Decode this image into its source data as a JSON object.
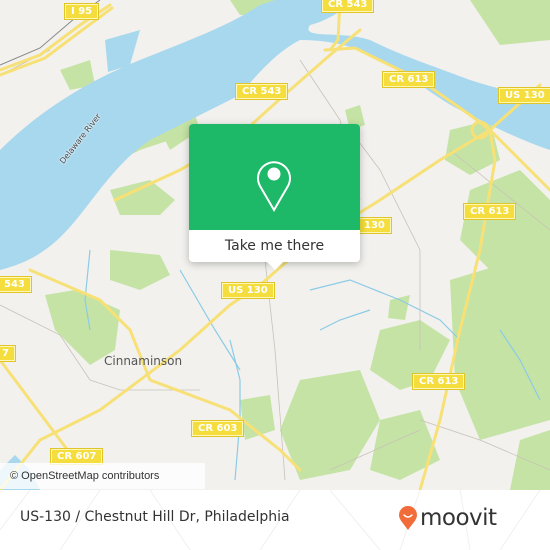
{
  "map": {
    "place_labels": [
      {
        "id": "cinnaminson",
        "text": "Cinnaminson"
      }
    ],
    "water_labels": [
      {
        "id": "delaware-river",
        "text": "Delaware River"
      }
    ],
    "road_shields": [
      {
        "id": "i95",
        "text": "I 95"
      },
      {
        "id": "cr543-top",
        "text": "CR 543"
      },
      {
        "id": "cr543-mid",
        "text": "CR 543"
      },
      {
        "id": "cr543-left",
        "text": "543"
      },
      {
        "id": "cr613-top",
        "text": "CR 613"
      },
      {
        "id": "us130-right",
        "text": "US 130"
      },
      {
        "id": "cr613-right",
        "text": "CR 613"
      },
      {
        "id": "us130-center",
        "text": "130"
      },
      {
        "id": "us130-left",
        "text": "US 130"
      },
      {
        "id": "cr607-left",
        "text": "7"
      },
      {
        "id": "cr613-bottom",
        "text": "CR 613"
      },
      {
        "id": "cr603",
        "text": "CR 603"
      },
      {
        "id": "cr607",
        "text": "CR 607"
      }
    ],
    "attribution": "© OpenStreetMap contributors",
    "colors": {
      "land": "#f2f1ee",
      "water": "#a8d8ee",
      "park": "#c5e3a5",
      "road": "#f7e176",
      "shield": "#f4dd3c"
    }
  },
  "popup": {
    "icon": "location-pin-icon",
    "button_label": "Take me there",
    "color": "#1db868"
  },
  "footer": {
    "title": "US-130 / Chestnut Hill Dr, Philadelphia",
    "brand": "moovit",
    "brand_color": "#f26c3a"
  }
}
